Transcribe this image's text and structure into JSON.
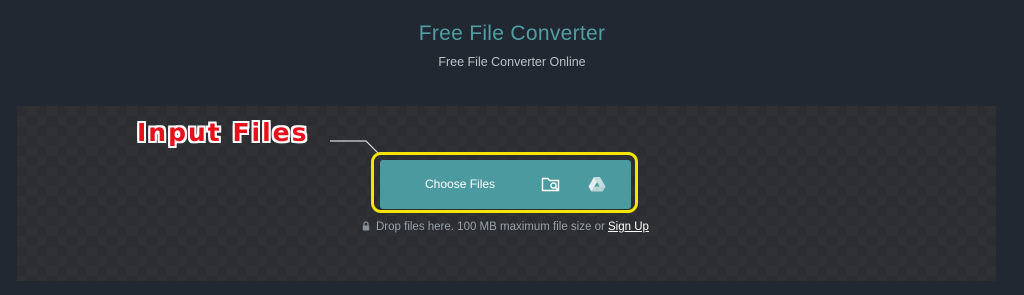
{
  "header": {
    "title": "Free File Converter",
    "subtitle": "Free File Converter Online"
  },
  "annotation": {
    "label": "Input Files",
    "highlight_color": "#f5e500",
    "label_color": "#e8101a"
  },
  "upload": {
    "choose_label": "Choose Files",
    "folder_icon": "folder-search-icon",
    "drive_icon": "google-drive-icon",
    "hint_text": "Drop files here. 100 MB maximum file size or",
    "signup_link": "Sign Up",
    "button_color": "#4b9aa0"
  },
  "colors": {
    "background": "#222831",
    "title": "#4e9ea3"
  }
}
